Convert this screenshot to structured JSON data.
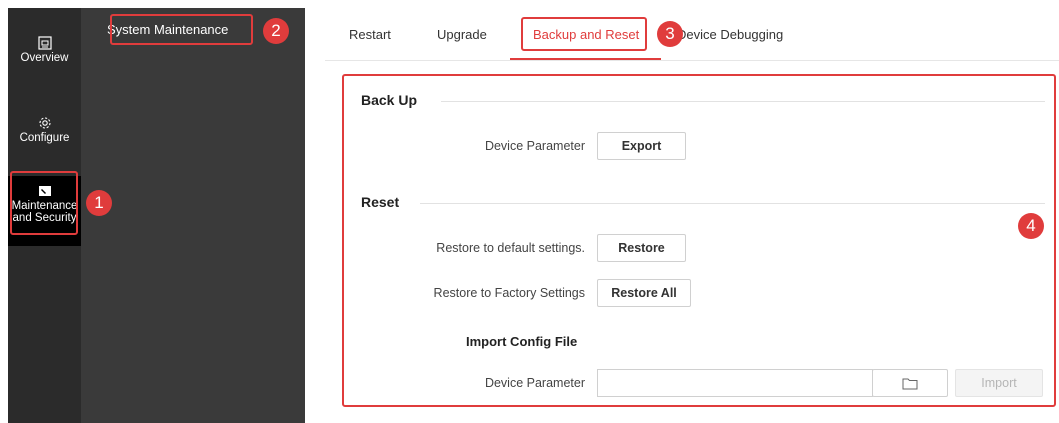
{
  "rail": {
    "items": [
      {
        "label": "Overview",
        "icon": "overview-icon"
      },
      {
        "label": "Configure",
        "icon": "gear-icon"
      },
      {
        "label_line1": "Maintenance",
        "label_line2": "and Security",
        "icon": "maintenance-icon"
      }
    ]
  },
  "submenu": {
    "item": "System Maintenance"
  },
  "tabs": [
    {
      "label": "Restart"
    },
    {
      "label": "Upgrade"
    },
    {
      "label": "Backup and Reset",
      "active": true
    },
    {
      "label": "Device Debugging"
    }
  ],
  "backup": {
    "title": "Back Up",
    "device_parameter_label": "Device Parameter",
    "export_label": "Export"
  },
  "reset": {
    "title": "Reset",
    "restore_default_label": "Restore to default settings.",
    "restore_button": "Restore",
    "restore_factory_label": "Restore to Factory Settings",
    "restore_all_button": "Restore All"
  },
  "import": {
    "title": "Import Config File",
    "device_parameter_label": "Device Parameter",
    "file_value": "",
    "browse_icon": "folder-icon",
    "import_button": "Import"
  },
  "annotations": {
    "badge1": "1",
    "badge2": "2",
    "badge3": "3",
    "badge4": "4"
  },
  "colors": {
    "accent": "#e03c3c",
    "rail_bg": "#2b2b2b",
    "submenu_bg": "#3a3a3a"
  }
}
